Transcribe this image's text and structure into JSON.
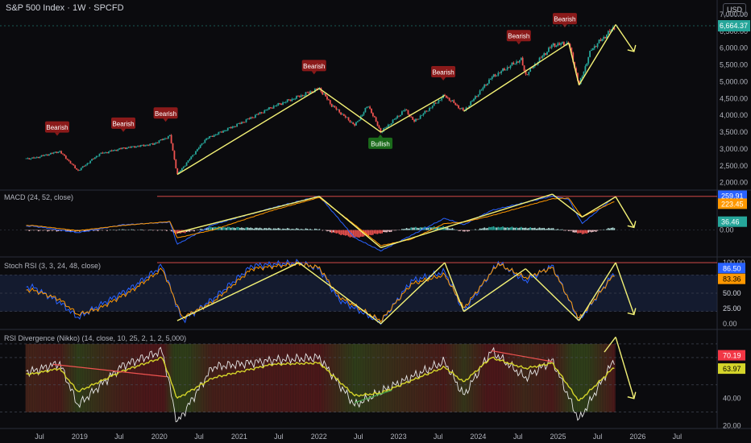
{
  "header": {
    "title": "S&P 500 Index · 1W · SPCFD",
    "currency": "USD"
  },
  "panes": {
    "macd_label": "MACD (24, 52, close)",
    "stoch_label": "Stoch RSI (3, 3, 24, 48, close)",
    "rsi_label": "RSI Divergence (Nikko) (14, close, 10, 25, 2, 1, 2, 5,000)"
  },
  "colors": {
    "background": "#0b0b0e",
    "up": "#26a69a",
    "down": "#ef5350",
    "trend": "#f4f276",
    "bearish": "#8b1a1a",
    "bullish": "#1b6b1b",
    "macd": "#2962ff",
    "signal": "#ff9800",
    "stoch_k": "#2962ff",
    "stoch_d": "#ff9800",
    "rsi": "#e6e6e6",
    "rsi_ma": "#d4d42a"
  },
  "chart_data": [
    {
      "type": "line",
      "title": "S&P 500 Index · 1W · SPCFD",
      "x": [
        "2018-06-01",
        "2018-10-01",
        "2018-12-24",
        "2019-04-01",
        "2019-07-15",
        "2019-12-01",
        "2020-02-19",
        "2020-03-23",
        "2020-08-01",
        "2021-01-01",
        "2021-06-01",
        "2022-01-03",
        "2022-03-01",
        "2022-06-15",
        "2022-08-15",
        "2022-10-12",
        "2023-02-01",
        "2023-03-13",
        "2023-07-31",
        "2023-10-27",
        "2024-03-01",
        "2024-07-15",
        "2024-08-05",
        "2024-12-06",
        "2025-02-19",
        "2025-04-07",
        "2025-06-01",
        "2025-09-22"
      ],
      "y": [
        2720,
        2930,
        2350,
        2850,
        3020,
        3140,
        3390,
        2240,
        3300,
        3750,
        4250,
        4800,
        4300,
        3700,
        4300,
        3500,
        4180,
        3810,
        4590,
        4120,
        5120,
        5670,
        5200,
        6090,
        6150,
        4900,
        5950,
        6664.37
      ],
      "ylim": [
        1800,
        7000
      ],
      "y_ticks": [
        2000,
        2500,
        3000,
        3500,
        4000,
        4500,
        5000,
        5500,
        6000,
        6500
      ],
      "y_tick_labels": [
        "2,000.00",
        "2,500.00",
        "3,000.00",
        "3,500.00",
        "4,000.00",
        "4,500.00",
        "5,000.00",
        "5,500.00",
        "6,000.00",
        "6,500.00"
      ],
      "partially_hidden_label": "7,000.00",
      "last_value_label": "6,664.37",
      "annotations": [
        {
          "text": "Bearish",
          "x": "2018-09-20"
        },
        {
          "text": "Bearish",
          "x": "2019-07-20"
        },
        {
          "text": "Bearish",
          "x": "2020-01-30"
        },
        {
          "text": "Bearish",
          "x": "2021-12-10"
        },
        {
          "text": "Bullish",
          "x": "2022-10-10"
        },
        {
          "text": "Bearish",
          "x": "2023-07-25"
        },
        {
          "text": "Bearish",
          "x": "2024-07-05"
        },
        {
          "text": "Bearish",
          "x": "2025-02-01"
        }
      ],
      "trend_lines": [
        [
          [
            "2020-03-23",
            2240
          ],
          [
            "2022-01-03",
            4800
          ]
        ],
        [
          [
            "2022-01-03",
            4800
          ],
          [
            "2022-10-12",
            3500
          ]
        ],
        [
          [
            "2022-10-12",
            3500
          ],
          [
            "2023-07-31",
            4590
          ]
        ],
        [
          [
            "2023-10-27",
            4120
          ],
          [
            "2025-02-19",
            6150
          ]
        ],
        [
          [
            "2025-02-19",
            6150
          ],
          [
            "2025-04-07",
            4900
          ]
        ],
        [
          [
            "2025-04-07",
            4900
          ],
          [
            "2025-09-22",
            6700
          ]
        ],
        [
          [
            "2025-09-22",
            6700
          ],
          [
            "2025-12-15",
            5900
          ]
        ]
      ]
    },
    {
      "type": "line",
      "title": "MACD (24, 52, close)",
      "x": [
        "2018-06-01",
        "2018-12-24",
        "2019-07-15",
        "2020-02-19",
        "2020-03-23",
        "2020-09-01",
        "2021-06-01",
        "2022-01-03",
        "2022-06-15",
        "2022-10-12",
        "2023-03-01",
        "2023-07-31",
        "2023-10-27",
        "2024-03-01",
        "2024-12-06",
        "2025-02-19",
        "2025-04-21",
        "2025-09-22"
      ],
      "macd": [
        30,
        -20,
        40,
        60,
        -110,
        40,
        170,
        260,
        -60,
        -160,
        -40,
        90,
        40,
        150,
        260,
        235,
        50,
        259.91
      ],
      "signal": [
        35,
        -5,
        35,
        65,
        -60,
        0,
        150,
        250,
        40,
        -120,
        -70,
        50,
        60,
        110,
        240,
        245,
        100,
        223.45
      ],
      "histogram_last": 36.46,
      "value_labels": [
        "259.91",
        "223.45",
        "36.46"
      ],
      "y_ticks": [
        0
      ],
      "y_tick_labels": [
        "0.00"
      ],
      "trend_lines": [
        [
          [
            "2020-03-23",
            -20
          ],
          [
            "2022-01-03",
            258
          ]
        ],
        [
          [
            "2022-01-03",
            258
          ],
          [
            "2022-10-12",
            -135
          ]
        ],
        [
          [
            "2022-10-12",
            -135
          ],
          [
            "2024-12-06",
            275
          ]
        ],
        [
          [
            "2024-12-06",
            275
          ],
          [
            "2025-04-21",
            100
          ]
        ],
        [
          [
            "2025-04-21",
            100
          ],
          [
            "2025-09-22",
            255
          ]
        ],
        [
          [
            "2025-09-22",
            255
          ],
          [
            "2025-12-15",
            20
          ]
        ]
      ]
    },
    {
      "type": "line",
      "title": "Stoch RSI (3, 3, 24, 48, close)",
      "x": [
        "2018-06-01",
        "2018-10-01",
        "2018-12-24",
        "2019-04-01",
        "2019-09-01",
        "2020-01-15",
        "2020-04-15",
        "2020-09-01",
        "2021-03-01",
        "2021-10-01",
        "2022-01-03",
        "2022-04-01",
        "2022-10-12",
        "2023-03-01",
        "2023-08-01",
        "2023-10-27",
        "2024-04-01",
        "2024-08-05",
        "2024-12-06",
        "2025-04-07",
        "2025-09-22"
      ],
      "k": [
        60,
        35,
        10,
        30,
        60,
        95,
        5,
        40,
        95,
        100,
        90,
        40,
        2,
        70,
        85,
        20,
        100,
        70,
        95,
        5,
        86.5
      ],
      "d": [
        55,
        40,
        15,
        25,
        55,
        90,
        10,
        35,
        90,
        98,
        92,
        45,
        5,
        65,
        80,
        25,
        98,
        75,
        92,
        8,
        83.36
      ],
      "ylim": [
        0,
        100
      ],
      "y_ticks": [
        0,
        25,
        50,
        75,
        100
      ],
      "y_tick_labels": [
        "0.00",
        "25.00",
        "50.00",
        "75.00",
        "100.00"
      ],
      "value_labels": [
        "86.50",
        "83.36"
      ],
      "trend_lines": [
        [
          [
            "2020-03-23",
            5
          ],
          [
            "2021-10-01",
            100
          ]
        ],
        [
          [
            "2021-10-01",
            100
          ],
          [
            "2022-10-12",
            0
          ]
        ],
        [
          [
            "2022-10-12",
            0
          ],
          [
            "2023-08-01",
            100
          ]
        ],
        [
          [
            "2023-08-01",
            100
          ],
          [
            "2023-10-27",
            20
          ]
        ],
        [
          [
            "2023-10-27",
            20
          ],
          [
            "2024-08-05",
            90
          ]
        ],
        [
          [
            "2024-08-05",
            90
          ],
          [
            "2025-04-07",
            5
          ]
        ],
        [
          [
            "2025-04-07",
            5
          ],
          [
            "2025-09-22",
            100
          ]
        ],
        [
          [
            "2025-09-22",
            100
          ],
          [
            "2025-12-15",
            15
          ]
        ]
      ]
    },
    {
      "type": "line",
      "title": "RSI Divergence (Nikko) (14, close, 10, 25, 2, 1, 2, 5,000)",
      "x": [
        "2018-06-01",
        "2018-10-01",
        "2018-12-24",
        "2019-07-15",
        "2020-01-15",
        "2020-03-23",
        "2020-09-01",
        "2021-06-01",
        "2022-01-03",
        "2022-06-15",
        "2022-10-12",
        "2023-07-31",
        "2023-10-27",
        "2024-03-01",
        "2024-08-05",
        "2024-12-06",
        "2025-04-07",
        "2025-09-22"
      ],
      "rsi": [
        60,
        66,
        35,
        64,
        75,
        22,
        63,
        68,
        70,
        35,
        45,
        67,
        42,
        75,
        55,
        68,
        24,
        70.19
      ],
      "rsi_ma": [
        58,
        62,
        45,
        60,
        70,
        40,
        55,
        65,
        66,
        42,
        44,
        63,
        52,
        70,
        62,
        66,
        38,
        63.97
      ],
      "ylim": [
        18,
        90
      ],
      "y_ticks": [
        20,
        40,
        60,
        80
      ],
      "y_tick_labels": [
        "20.00",
        "40.00",
        "60.00",
        "80.00"
      ],
      "value_labels": [
        "70.19",
        "63.97"
      ],
      "trend_lines": [
        [
          [
            "2025-09-22",
            85
          ],
          [
            "2025-12-15",
            40
          ]
        ]
      ]
    }
  ],
  "time_axis": {
    "labels": [
      "Jul",
      "2019",
      "Jul",
      "2020",
      "Jul",
      "2021",
      "Jul",
      "2022",
      "Jul",
      "2023",
      "Jul",
      "2024",
      "Jul",
      "2025",
      "Jul",
      "2026",
      "Jul"
    ],
    "dates": [
      "2018-07-01",
      "2019-01-01",
      "2019-07-01",
      "2020-01-01",
      "2020-07-01",
      "2021-01-01",
      "2021-07-01",
      "2022-01-01",
      "2022-07-01",
      "2023-01-01",
      "2023-07-01",
      "2024-01-01",
      "2024-07-01",
      "2025-01-01",
      "2025-07-01",
      "2026-01-01",
      "2026-07-01"
    ]
  }
}
